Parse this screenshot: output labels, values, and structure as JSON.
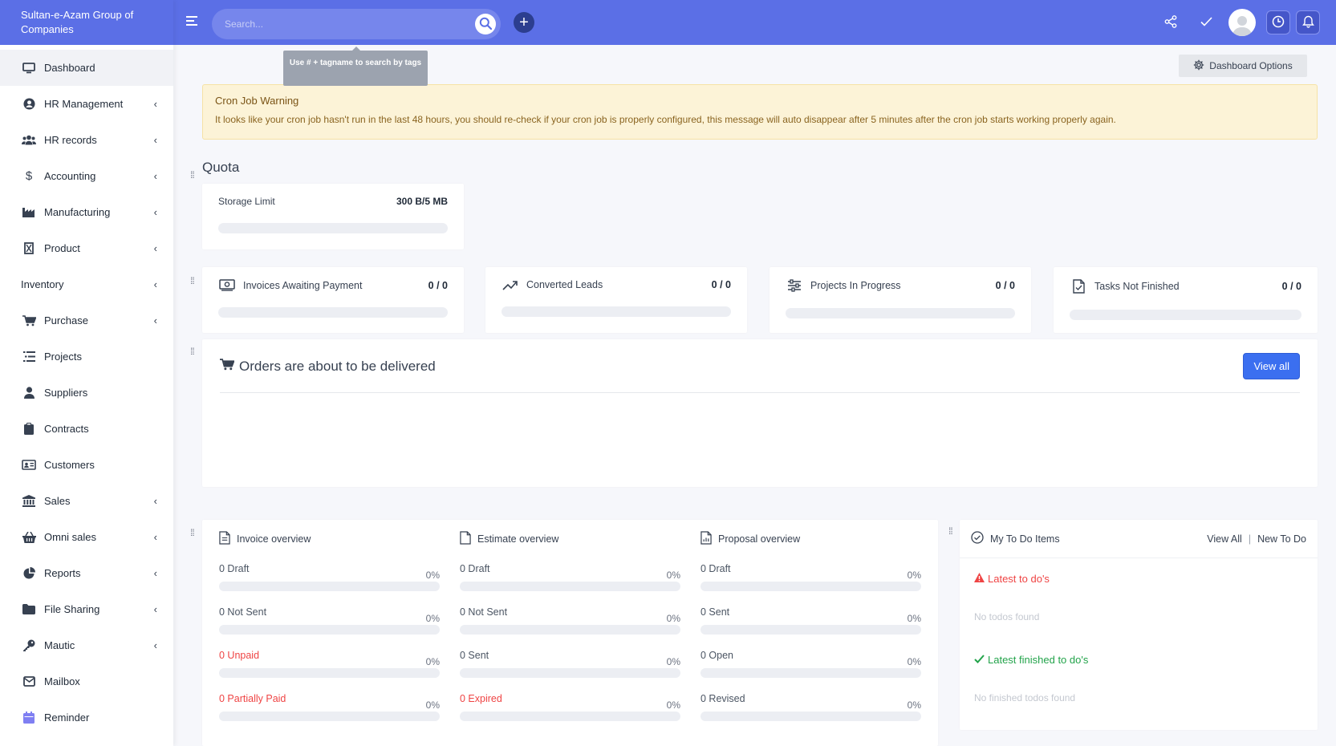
{
  "brand": "Sultan-e-Azam Group of Companies",
  "sidebar": {
    "items": [
      {
        "label": "Dashboard",
        "icon": "monitor-icon",
        "chevron": false
      },
      {
        "label": "HR Management",
        "icon": "user-circle-icon",
        "chevron": true
      },
      {
        "label": "HR records",
        "icon": "users-icon",
        "chevron": true
      },
      {
        "label": "Accounting",
        "icon": "dollar-icon",
        "chevron": true
      },
      {
        "label": "Manufacturing",
        "icon": "industry-icon",
        "chevron": true
      },
      {
        "label": "Product",
        "icon": "box-icon",
        "chevron": true
      },
      {
        "label": "Inventory",
        "icon": "",
        "chevron": true
      },
      {
        "label": "Purchase",
        "icon": "cart-icon",
        "chevron": true
      },
      {
        "label": "Projects",
        "icon": "tasks-icon",
        "chevron": false
      },
      {
        "label": "Suppliers",
        "icon": "user-icon",
        "chevron": false
      },
      {
        "label": "Contracts",
        "icon": "file-contract-icon",
        "chevron": false
      },
      {
        "label": "Customers",
        "icon": "id-card-icon",
        "chevron": false
      },
      {
        "label": "Sales",
        "icon": "bank-icon",
        "chevron": true
      },
      {
        "label": "Omni sales",
        "icon": "basket-icon",
        "chevron": true
      },
      {
        "label": "Reports",
        "icon": "pie-chart-icon",
        "chevron": true
      },
      {
        "label": "File Sharing",
        "icon": "folder-icon",
        "chevron": true
      },
      {
        "label": "Mautic",
        "icon": "key-icon",
        "chevron": true
      },
      {
        "label": "Mailbox",
        "icon": "envelope-icon",
        "chevron": false
      },
      {
        "label": "Reminder",
        "icon": "calendar-icon",
        "chevron": false
      }
    ]
  },
  "header": {
    "search_placeholder": "Search...",
    "tooltip": "Use # + tagname to search by tags"
  },
  "dashboard_options": "Dashboard Options",
  "warning": {
    "title": "Cron Job Warning",
    "text": "It looks like your cron job hasn't run in the last 48 hours, you should re-check if your cron job is properly configured, this message will auto disappear after 5 minutes after the cron job starts working properly again."
  },
  "quota": {
    "title": "Quota",
    "storage_label": "Storage Limit",
    "storage_value": "300 B/5 MB"
  },
  "stats": [
    {
      "label": "Invoices Awaiting Payment",
      "value": "0 / 0",
      "icon": "money-icon"
    },
    {
      "label": "Converted Leads",
      "value": "0 / 0",
      "icon": "trend-up-icon"
    },
    {
      "label": "Projects In Progress",
      "value": "0 / 0",
      "icon": "sliders-icon"
    },
    {
      "label": "Tasks Not Finished",
      "value": "0 / 0",
      "icon": "file-check-icon"
    }
  ],
  "orders": {
    "title": "Orders are about to be delivered",
    "view_all": "View all"
  },
  "overview": {
    "invoice": {
      "title": "Invoice overview",
      "rows": [
        {
          "label": "0 Draft",
          "pct": "0%",
          "red": false
        },
        {
          "label": "0 Not Sent",
          "pct": "0%",
          "red": false
        },
        {
          "label": "0 Unpaid",
          "pct": "0%",
          "red": true
        },
        {
          "label": "0 Partially Paid",
          "pct": "0%",
          "red": true
        }
      ]
    },
    "estimate": {
      "title": "Estimate overview",
      "rows": [
        {
          "label": "0 Draft",
          "pct": "0%",
          "red": false
        },
        {
          "label": "0 Not Sent",
          "pct": "0%",
          "red": false
        },
        {
          "label": "0 Sent",
          "pct": "0%",
          "red": false
        },
        {
          "label": "0 Expired",
          "pct": "0%",
          "red": true
        }
      ]
    },
    "proposal": {
      "title": "Proposal overview",
      "rows": [
        {
          "label": "0 Draft",
          "pct": "0%",
          "red": false
        },
        {
          "label": "0 Sent",
          "pct": "0%",
          "red": false
        },
        {
          "label": "0 Open",
          "pct": "0%",
          "red": false
        },
        {
          "label": "0 Revised",
          "pct": "0%",
          "red": false
        }
      ]
    }
  },
  "todo": {
    "title": "My To Do Items",
    "view_all": "View All",
    "new_todo": "New To Do",
    "latest": "Latest to do's",
    "no_todos": "No todos found",
    "latest_finished": "Latest finished to do's",
    "no_finished": "No finished todos found"
  },
  "colors": {
    "brand_blue": "#5b6fe6",
    "warning_bg": "#fcf3d7",
    "danger": "#ef4444",
    "success": "#22a34a",
    "primary_button": "#3b6ff0"
  }
}
